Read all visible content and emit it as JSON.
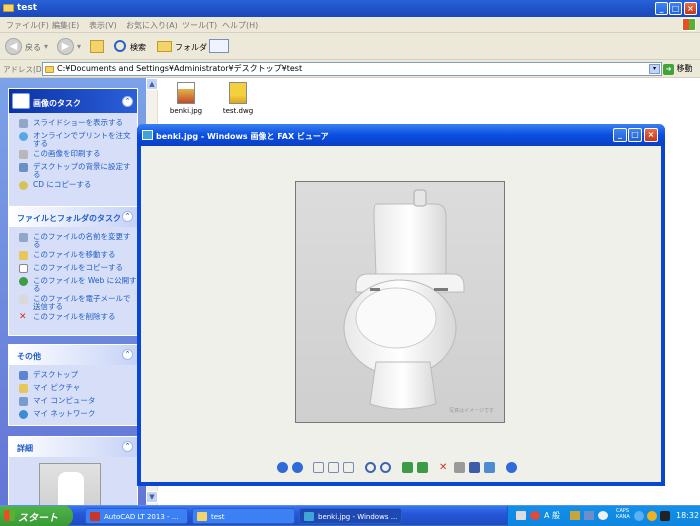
{
  "explorer": {
    "title": "test",
    "menu": [
      "ファイル(F)",
      "編集(E)",
      "表示(V)",
      "お気に入り(A)",
      "ツール(T)",
      "ヘルプ(H)"
    ],
    "toolbar": {
      "back": "戻る",
      "search": "検索",
      "folders": "フォルダ"
    },
    "address_label": "アドレス(D)",
    "address_value": "C:¥Documents and Settings¥Administrator¥デスクトップ¥test",
    "go_label": "移動"
  },
  "taskpane": {
    "image_tasks": {
      "title": "画像のタスク",
      "items": [
        "スライドショーを表示する",
        "オンラインでプリントを注文する",
        "この画像を印刷する",
        "デスクトップの背景に設定する",
        "CD にコピーする"
      ]
    },
    "file_tasks": {
      "title": "ファイルとフォルダのタスク",
      "items": [
        "このファイルの名前を変更する",
        "このファイルを移動する",
        "このファイルをコピーする",
        "このファイルを Web に公開する",
        "このファイルを電子メールで送信する",
        "このファイルを削除する"
      ]
    },
    "other": {
      "title": "その他",
      "items": [
        "デスクトップ",
        "マイ ピクチャ",
        "マイ コンピュータ",
        "マイ ネットワーク"
      ]
    },
    "details": {
      "title": "詳細"
    }
  },
  "files": [
    {
      "name": "benki.jpg",
      "type": "jpg"
    },
    {
      "name": "test.dwg",
      "type": "dwg"
    }
  ],
  "viewer": {
    "title": "benki.jpg - Windows 画像と FAX ビューア",
    "photo_caption": "写真はイメージです"
  },
  "taskbar": {
    "start": "スタート",
    "tasks": [
      "AutoCAD LT 2013 - ...",
      "test",
      "benki.jpg - Windows ..."
    ],
    "ime": "A 般",
    "clock": "18:32"
  }
}
